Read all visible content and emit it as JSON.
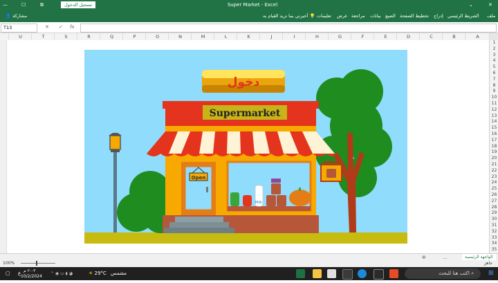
{
  "window": {
    "title": "Super Market  -  Excel",
    "signin_label": "تسجيل الدخول",
    "controls": [
      "✕",
      "☐",
      "—",
      "⧉"
    ],
    "pin": "⌄"
  },
  "ribbon": {
    "tabs": [
      "ملف",
      "الشريط الرئيسي",
      "إدراج",
      "تخطيط الصفحة",
      "الصيغ",
      "بيانات",
      "مراجعة",
      "عرض",
      "تعليمات"
    ],
    "tell_me": "أخبرني بما تريد القيام به",
    "share_label": "مشاركة"
  },
  "formula_bar": {
    "name_box": "T13",
    "fx": "fx",
    "cancel": "✕",
    "enter": "✓",
    "value": ""
  },
  "columns": [
    "U",
    "T",
    "S",
    "R",
    "Q",
    "P",
    "O",
    "N",
    "M",
    "L",
    "K",
    "J",
    "I",
    "H",
    "G",
    "F",
    "E",
    "D",
    "C",
    "B",
    "A"
  ],
  "rows": [
    "1",
    "2",
    "3",
    "4",
    "5",
    "6",
    "7",
    "8",
    "9",
    "10",
    "11",
    "12",
    "13",
    "14",
    "15",
    "16",
    "17",
    "18",
    "19",
    "20",
    "21",
    "22",
    "23",
    "24",
    "25",
    "26",
    "27",
    "28",
    "29",
    "30",
    "31",
    "32",
    "33",
    "34",
    "35"
  ],
  "scene": {
    "button_label": "دخول",
    "store_sign": "Supermarket",
    "door_sign": "Open",
    "milk_label": "Milk"
  },
  "sheets": {
    "active": "الواجهة الرئيسية",
    "more": "...",
    "add": "⊕"
  },
  "status": {
    "ready": "جاهز",
    "zoom": "100%"
  },
  "taskbar": {
    "search_placeholder": "اكتب هنا للبحث",
    "weather_temp": "29°C",
    "weather_text": "مشمس",
    "time": "٢:٠٣ م",
    "date": "10/2/2024",
    "lang": "ع"
  }
}
